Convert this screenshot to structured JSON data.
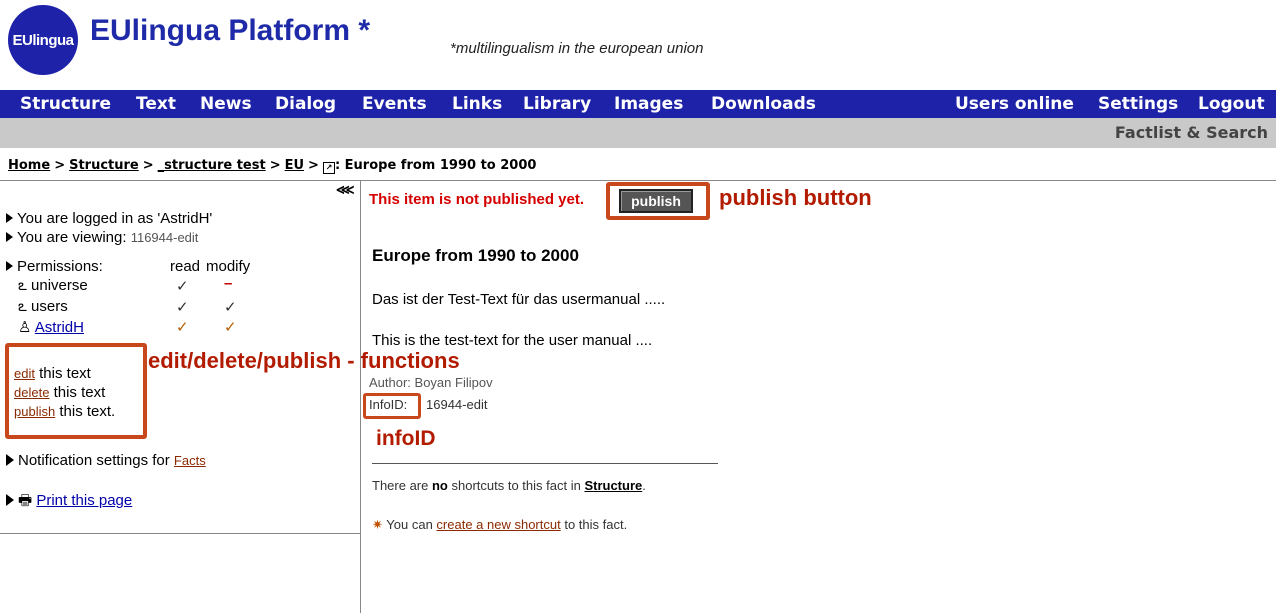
{
  "header": {
    "logo_text": "EUlingua",
    "title": "EUlingua Platform *",
    "tagline": "*multilingualism in the european union"
  },
  "nav": {
    "items": [
      "Structure",
      "Text",
      "News",
      "Dialog",
      "Events",
      "Links",
      "Library",
      "Images",
      "Downloads"
    ],
    "right_items": [
      "Users online",
      "Settings",
      "Logout"
    ]
  },
  "subbar": {
    "link": "Factlist & Search"
  },
  "breadcrumb": {
    "items": [
      "Home",
      "Structure",
      "_structure test",
      "EU"
    ],
    "current": ": Europe from 1990 to 2000"
  },
  "sidebar": {
    "collapse_label": "⋘",
    "logged_in": "You are logged in as 'AstridH'",
    "viewing_label": "You are viewing:",
    "viewing_value": "116944-edit",
    "permissions_label": "Permissions:",
    "perm_read": "read",
    "perm_modify": "modify",
    "perm_rows": [
      {
        "name": "universe",
        "read": "✓",
        "modify": "–"
      },
      {
        "name": "users",
        "read": "✓",
        "modify": "✓"
      },
      {
        "name": "AstridH",
        "read": "✓",
        "modify": "✓"
      }
    ],
    "actions": [
      {
        "link": "edit",
        "rest": " this text"
      },
      {
        "link": "delete",
        "rest": " this text"
      },
      {
        "link": "publish",
        "rest": " this text."
      }
    ],
    "notification_label": "Notification settings for ",
    "notification_link": "Facts",
    "print_link": "Print this page"
  },
  "main": {
    "not_published": "This item is not published yet.",
    "publish_label": "publish",
    "title": "Europe from 1990 to 2000",
    "text_de": "Das ist der Test-Text für das usermanual .....",
    "text_en": "This is the test-text for the user manual ....",
    "author": "Author: Boyan Filipov",
    "infoid_label": "InfoID:",
    "infoid_value": "16944-edit",
    "shortcuts_pre": "There are ",
    "shortcuts_no": "no",
    "shortcuts_mid": " shortcuts to this fact in ",
    "shortcuts_link": "Structure",
    "shortcuts_end": ".",
    "create_pre": "You can ",
    "create_link": "create a new shortcut",
    "create_end": " to this fact."
  },
  "annotations": {
    "publish_button": "publish button",
    "functions": "edit/delete/publish - functions",
    "infoid": "infoID"
  },
  "colors": {
    "brand": "#1e22a8",
    "annotation": "#b21b00",
    "subbar": "#c9c9c9"
  }
}
